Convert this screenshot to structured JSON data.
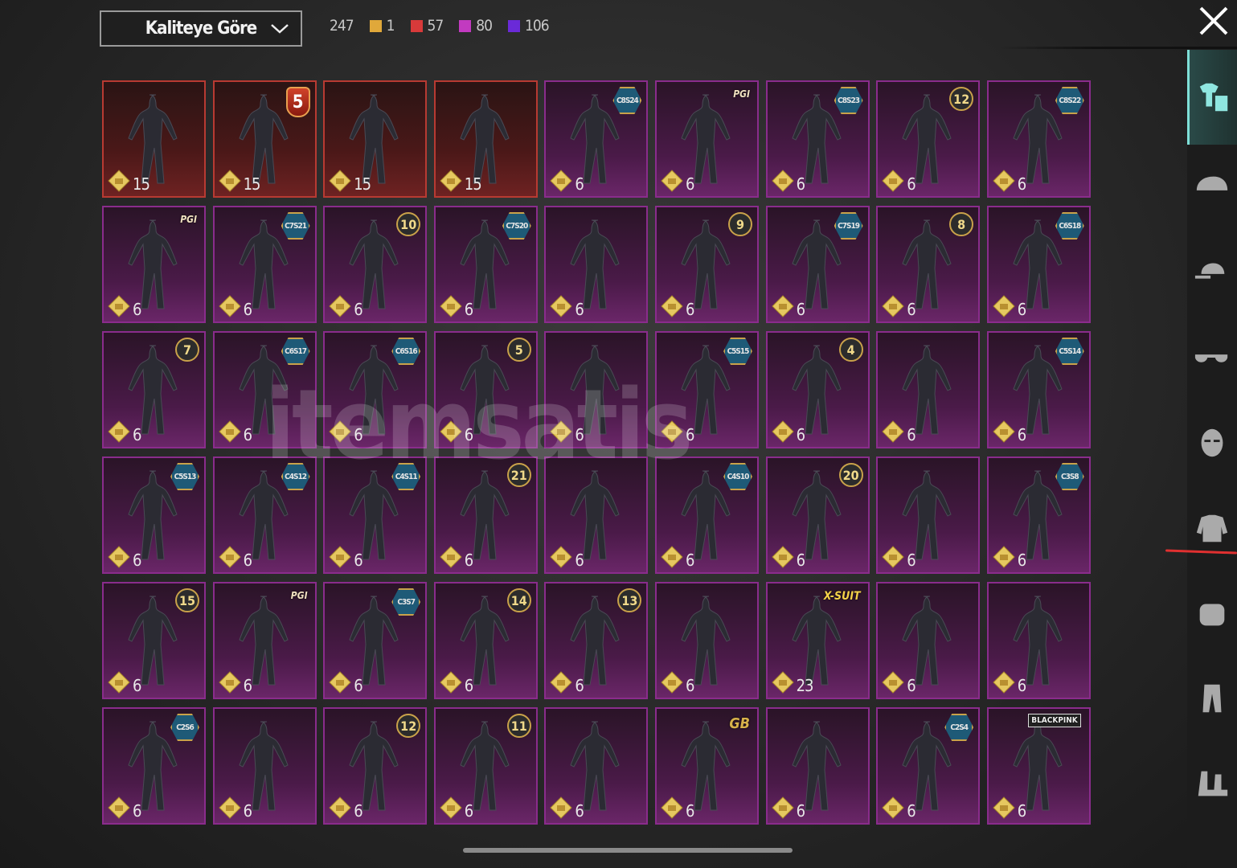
{
  "sort_dropdown": {
    "label": "Kaliteye Göre"
  },
  "counts": {
    "total": "247",
    "legendary": "1",
    "mythic": "57",
    "epic": "80",
    "rare": "106",
    "colors": {
      "legendary": "#e0a83a",
      "mythic": "#d83a3a",
      "epic": "#c23ac0",
      "rare": "#6a2ad8"
    }
  },
  "watermark": "itemsatis",
  "sidebar": [
    "outfit-icon",
    "helmet-icon",
    "cap-icon",
    "glasses-icon",
    "mask-icon",
    "jacket-icon",
    "backpack-icon",
    "pants-icon",
    "shoes-icon"
  ],
  "items": [
    {
      "v": "15",
      "r": 1
    },
    {
      "v": "15",
      "r": 1,
      "b": "5",
      "t": "shield"
    },
    {
      "v": "15",
      "r": 1
    },
    {
      "v": "15",
      "r": 1
    },
    {
      "v": "6",
      "b": "C8S24",
      "t": "hex"
    },
    {
      "v": "6",
      "b": "PGI",
      "t": "logo"
    },
    {
      "v": "6",
      "b": "C8S23",
      "t": "hex"
    },
    {
      "v": "6",
      "b": "12",
      "t": "round"
    },
    {
      "v": "6",
      "b": "C8S22",
      "t": "hex"
    },
    {
      "v": "6",
      "b": "PGI",
      "t": "logo"
    },
    {
      "v": "6",
      "b": "C7S21",
      "t": "hex"
    },
    {
      "v": "6",
      "b": "10",
      "t": "round"
    },
    {
      "v": "6",
      "b": "C7S20",
      "t": "hex"
    },
    {
      "v": "6"
    },
    {
      "v": "6",
      "b": "9",
      "t": "round"
    },
    {
      "v": "6",
      "b": "C7S19",
      "t": "hex"
    },
    {
      "v": "6",
      "b": "8",
      "t": "round"
    },
    {
      "v": "6",
      "b": "C6S18",
      "t": "hex"
    },
    {
      "v": "6",
      "b": "7",
      "t": "round"
    },
    {
      "v": "6",
      "b": "C6S17",
      "t": "hex"
    },
    {
      "v": "6",
      "b": "C6S16",
      "t": "hex"
    },
    {
      "v": "6",
      "b": "5",
      "t": "round"
    },
    {
      "v": "6"
    },
    {
      "v": "6",
      "b": "C5S15",
      "t": "hex"
    },
    {
      "v": "6",
      "b": "4",
      "t": "round"
    },
    {
      "v": "6"
    },
    {
      "v": "6",
      "b": "C5S14",
      "t": "hex"
    },
    {
      "v": "6",
      "b": "C5S13",
      "t": "hex"
    },
    {
      "v": "6",
      "b": "C4S12",
      "t": "hex"
    },
    {
      "v": "6",
      "b": "C4S11",
      "t": "hex"
    },
    {
      "v": "6",
      "b": "21",
      "t": "round"
    },
    {
      "v": "6"
    },
    {
      "v": "6",
      "b": "C4S10",
      "t": "hex"
    },
    {
      "v": "6",
      "b": "20",
      "t": "round"
    },
    {
      "v": "6"
    },
    {
      "v": "6",
      "b": "C3S8",
      "t": "hex"
    },
    {
      "v": "6",
      "b": "15",
      "t": "round"
    },
    {
      "v": "6",
      "b": "PGI",
      "t": "logo"
    },
    {
      "v": "6",
      "b": "C3S7",
      "t": "hex"
    },
    {
      "v": "6",
      "b": "14",
      "t": "round"
    },
    {
      "v": "6",
      "b": "13",
      "t": "round"
    },
    {
      "v": "6"
    },
    {
      "v": "23",
      "b": "X-SUIT",
      "t": "logo xs"
    },
    {
      "v": "6"
    },
    {
      "v": "6"
    },
    {
      "v": "6",
      "b": "C2S6",
      "t": "hex"
    },
    {
      "v": "6"
    },
    {
      "v": "6",
      "b": "12",
      "t": "round"
    },
    {
      "v": "6",
      "b": "11",
      "t": "round"
    },
    {
      "v": "6"
    },
    {
      "v": "6",
      "b": "GB",
      "t": "logo gb"
    },
    {
      "v": "6"
    },
    {
      "v": "6",
      "b": "C2S4",
      "t": "hex"
    },
    {
      "v": "6",
      "b": "BLACKPINK",
      "t": "logo bp"
    }
  ]
}
